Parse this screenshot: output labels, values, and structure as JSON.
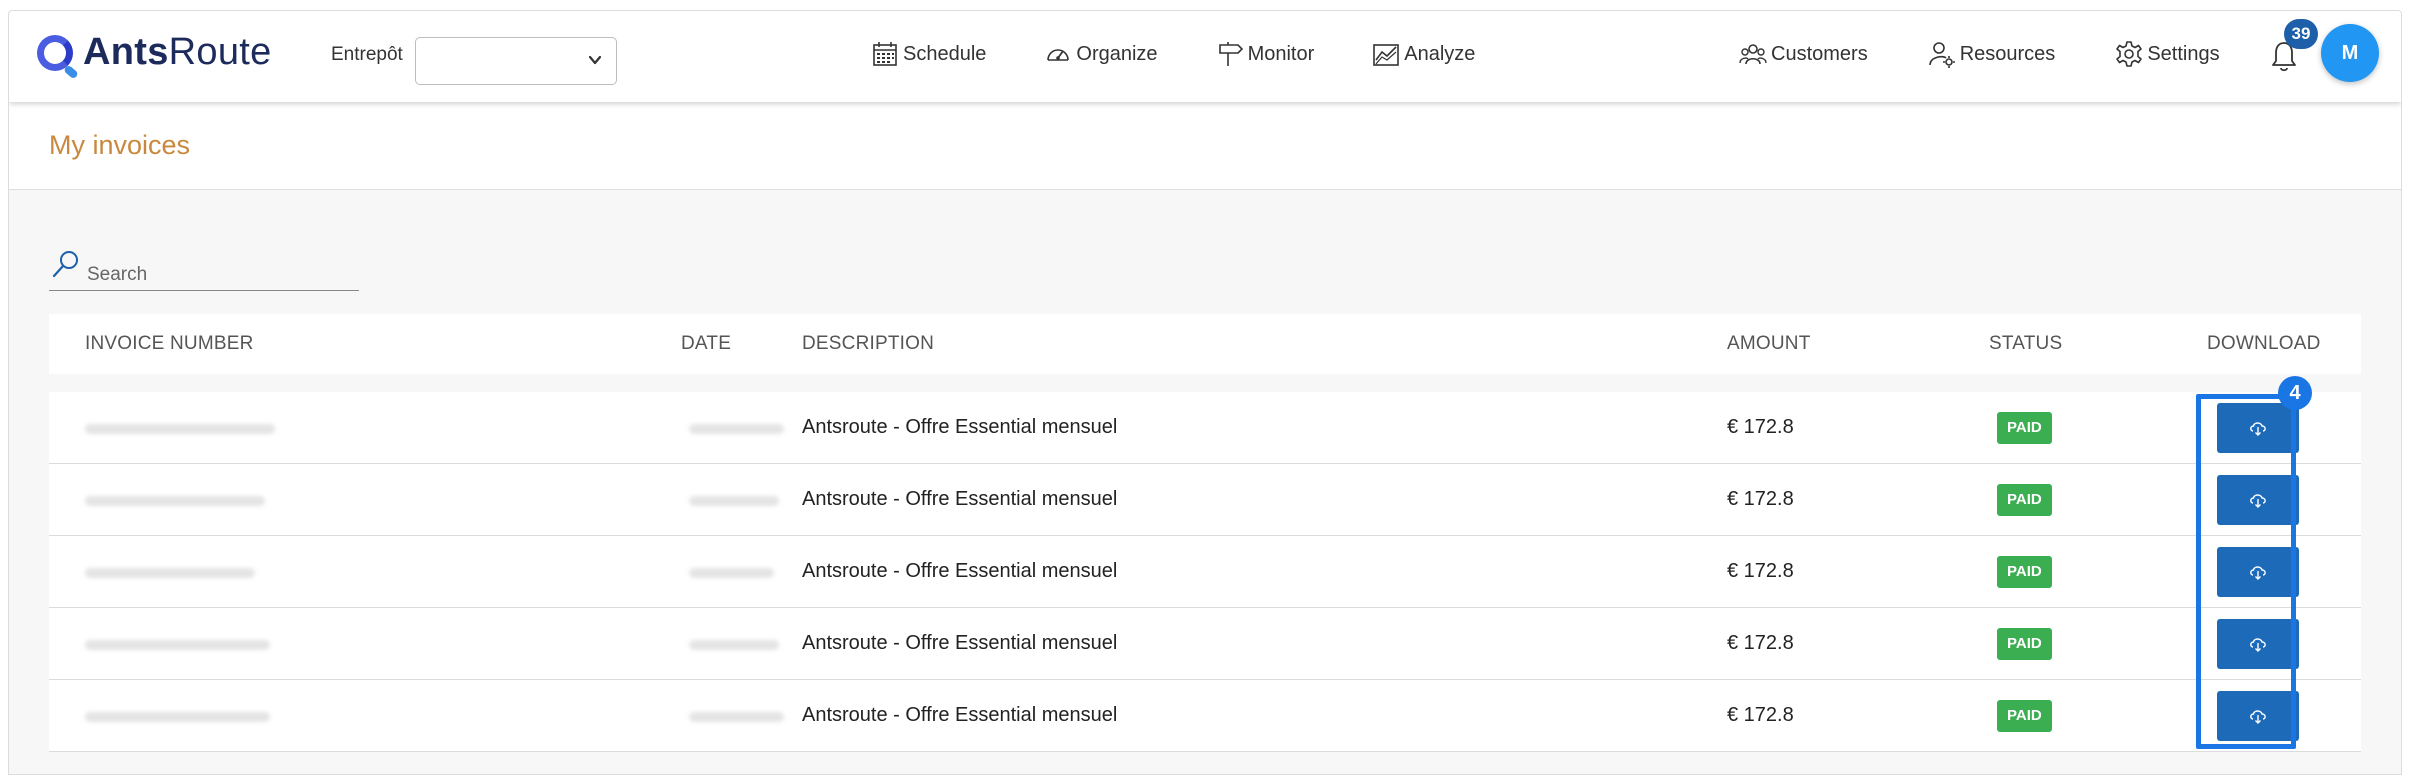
{
  "app": {
    "logo_bold": "Ants",
    "logo_regular": "Route"
  },
  "header": {
    "warehouse_label": "Entrepôt",
    "warehouse_value": "",
    "nav": [
      {
        "label": "Schedule",
        "icon": "calendar-icon"
      },
      {
        "label": "Organize",
        "icon": "gauge-icon"
      },
      {
        "label": "Monitor",
        "icon": "signpost-icon"
      },
      {
        "label": "Analyze",
        "icon": "chart-icon"
      }
    ],
    "nav_right": [
      {
        "label": "Customers",
        "icon": "users-icon"
      },
      {
        "label": "Resources",
        "icon": "user-gear-icon"
      },
      {
        "label": "Settings",
        "icon": "gear-icon"
      }
    ],
    "notifications_count": "39",
    "avatar_initial": "M"
  },
  "page": {
    "title": "My invoices"
  },
  "search": {
    "placeholder": "Search"
  },
  "table": {
    "columns": {
      "invoice_number": "INVOICE NUMBER",
      "date": "DATE",
      "description": "DESCRIPTION",
      "amount": "AMOUNT",
      "status": "STATUS",
      "download": "DOWNLOAD"
    },
    "rows": [
      {
        "description": "Antsroute - Offre Essential mensuel",
        "amount": "€ 172.8",
        "status": "PAID"
      },
      {
        "description": "Antsroute - Offre Essential mensuel",
        "amount": "€ 172.8",
        "status": "PAID"
      },
      {
        "description": "Antsroute - Offre Essential mensuel",
        "amount": "€ 172.8",
        "status": "PAID"
      },
      {
        "description": "Antsroute - Offre Essential mensuel",
        "amount": "€ 172.8",
        "status": "PAID"
      },
      {
        "description": "Antsroute - Offre Essential mensuel",
        "amount": "€ 172.8",
        "status": "PAID"
      }
    ]
  },
  "annotation": {
    "badge": "4"
  },
  "colors": {
    "accent_title": "#c8893e",
    "download_button": "#1d6bb8",
    "paid_badge": "#3cae52",
    "highlight": "#1976e4",
    "avatar": "#2196f3"
  }
}
